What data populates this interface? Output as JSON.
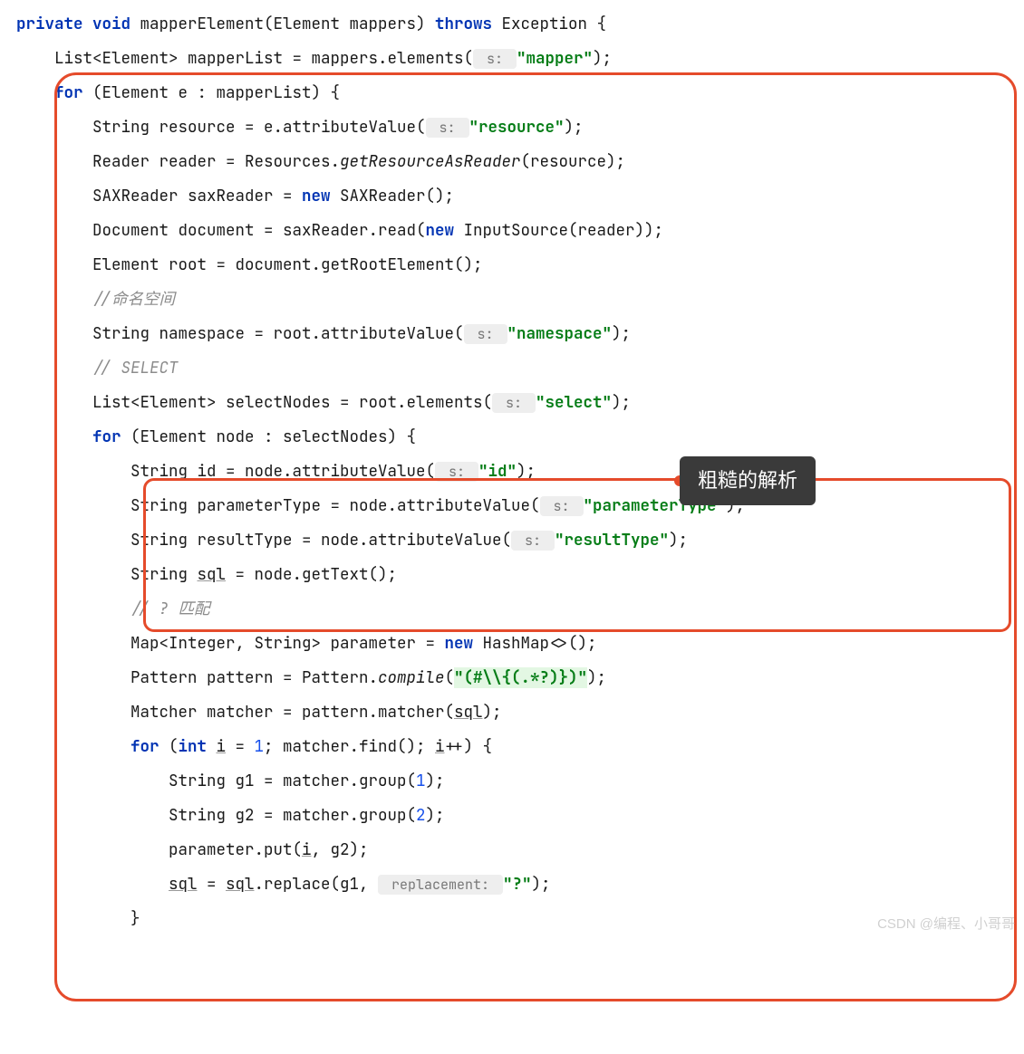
{
  "code": {
    "l1": {
      "p1": "private void",
      "p2": " mapperElement(Element mappers) ",
      "p3": "throws",
      "p4": " Exception {"
    },
    "l2": {
      "p1": "    List<Element> mapperList = mappers.elements(",
      "hint": " s: ",
      "p2": "\"mapper\"",
      "p3": ");"
    },
    "l3": {
      "p1": "for",
      "p2": " (Element e : mapperList) {"
    },
    "l4": {
      "p1": "        String resource = e.attributeValue(",
      "hint": " s: ",
      "p2": "\"resource\"",
      "p3": ");"
    },
    "l5": {
      "p1": "        Reader reader = Resources.",
      "p2": "getResourceAsReader",
      "p3": "(resource);"
    },
    "l6": {
      "p1": "        SAXReader saxReader = ",
      "p2": "new",
      "p3": " SAXReader();"
    },
    "l7": {
      "p1": "        Document document = saxReader.read(",
      "p2": "new",
      "p3": " InputSource(reader));"
    },
    "l8": {
      "p1": "        Element root = document.getRootElement();"
    },
    "l9": {
      "p1": "        ",
      "c": "//命名空间"
    },
    "l10": {
      "p1": "        String namespace = root.attributeValue(",
      "hint": " s: ",
      "p2": "\"namespace\"",
      "p3": ");"
    },
    "l11": {
      "p1": ""
    },
    "l12": {
      "p1": "        ",
      "c": "// SELECT"
    },
    "l13": {
      "p1": "        List<Element> selectNodes = root.elements(",
      "hint": " s: ",
      "p2": "\"select\"",
      "p3": ");"
    },
    "l14": {
      "p1": "        ",
      "p2": "for",
      "p3": " (Element node : selectNodes) {"
    },
    "l15": {
      "p1": "            String id = node.attributeValue(",
      "hint": " s: ",
      "p2": "\"id\"",
      "p3": ");"
    },
    "l16": {
      "p1": "            String parameterType = node.attributeValue(",
      "hint": " s: ",
      "p2": "\"parameterType\"",
      "p3": ");"
    },
    "l17": {
      "p1": "            String resultType = node.attributeValue(",
      "hint": " s: ",
      "p2": "\"resultType\"",
      "p3": ");"
    },
    "l18": {
      "p1": "            String ",
      "u": "sql",
      "p2": " = node.getText();"
    },
    "l19": {
      "p1": ""
    },
    "l20": {
      "p1": "            ",
      "c": "// ? 匹配"
    },
    "l21": {
      "p1": "            Map<Integer, String> parameter = ",
      "p2": "new",
      "p3": " HashMap<>();"
    },
    "l22": {
      "p1": "            Pattern pattern = Pattern.",
      "p2": "compile",
      "p3": "(",
      "hl": "\"(#\\\\{(.*?)})\"",
      "p4": ");"
    },
    "l23": {
      "p1": "            Matcher matcher = pattern.matcher(",
      "u": "sql",
      "p2": ");"
    },
    "l24": {
      "p1": "            ",
      "p2": "for",
      "p3": " (",
      "p4": "int",
      "p5": " ",
      "u1": "i",
      "p6": " = ",
      "n": "1",
      "p7": "; matcher.find(); ",
      "u2": "i",
      "p8": "++) {"
    },
    "l25": {
      "p1": "                String g1 = matcher.group(",
      "n": "1",
      "p2": ");"
    },
    "l26": {
      "p1": "                String g2 = matcher.group(",
      "n": "2",
      "p2": ");"
    },
    "l27": {
      "p1": "                parameter.put(",
      "u": "i",
      "p2": ", g2);"
    },
    "l28": {
      "p1": "                ",
      "u1": "sql",
      "p2": " = ",
      "u2": "sql",
      "p3": ".replace(g1, ",
      "hint": " replacement: ",
      "p4": "\"?\"",
      "p5": ");"
    },
    "l29": {
      "p1": "            }"
    }
  },
  "callout": "粗糙的解析",
  "watermark": "CSDN @编程、小哥哥"
}
